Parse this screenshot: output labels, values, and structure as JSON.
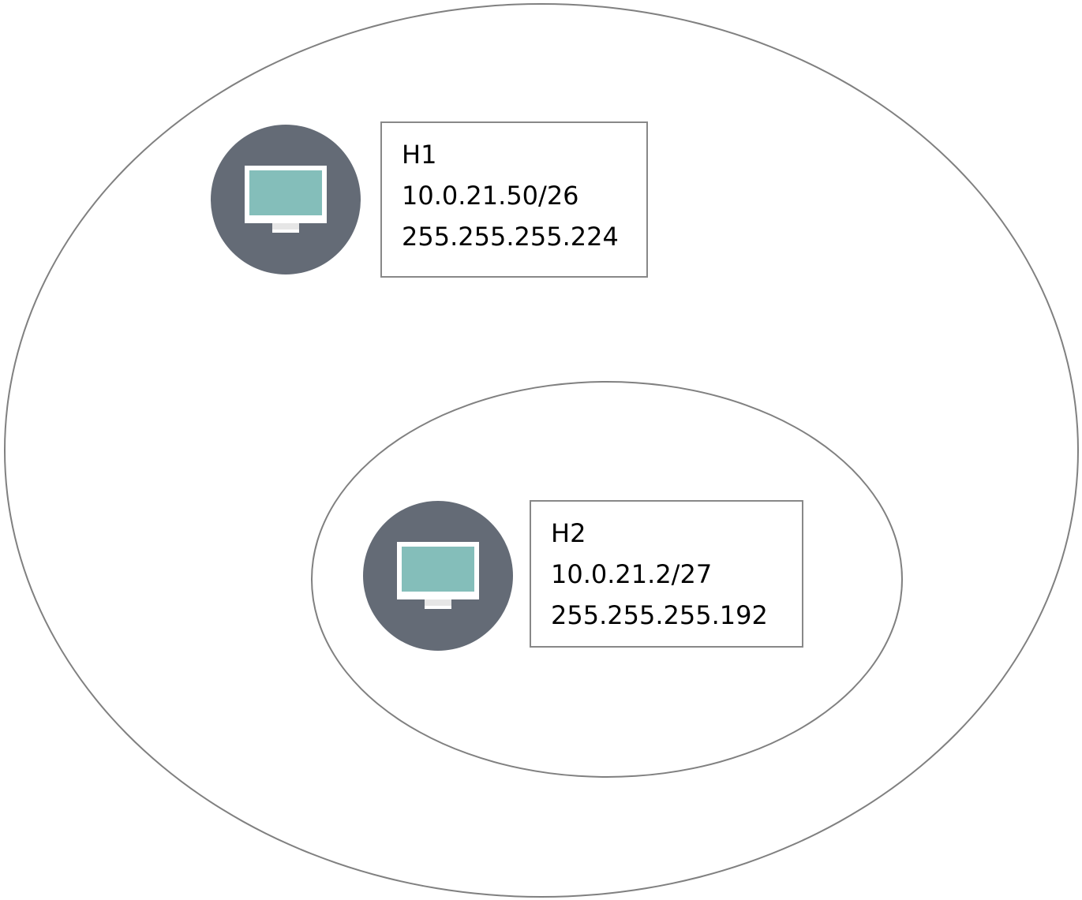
{
  "colors": {
    "zone_border": "#808080",
    "box_border": "#888888",
    "icon_circle": "#646b76",
    "screen": "#84beba",
    "monitor_frame": "#ffffff",
    "monitor_stand": "#e6e6e6",
    "text": "#000000"
  },
  "zones": [
    {
      "name": "outer-network-zone"
    },
    {
      "name": "inner-network-zone"
    }
  ],
  "hosts": [
    {
      "icon": "desktop-monitor-icon",
      "name": "H1",
      "address": "10.0.21.50/26",
      "mask": "255.255.255.224"
    },
    {
      "icon": "desktop-monitor-icon",
      "name": "H2",
      "address": "10.0.21.2/27",
      "mask": "255.255.255.192"
    }
  ]
}
